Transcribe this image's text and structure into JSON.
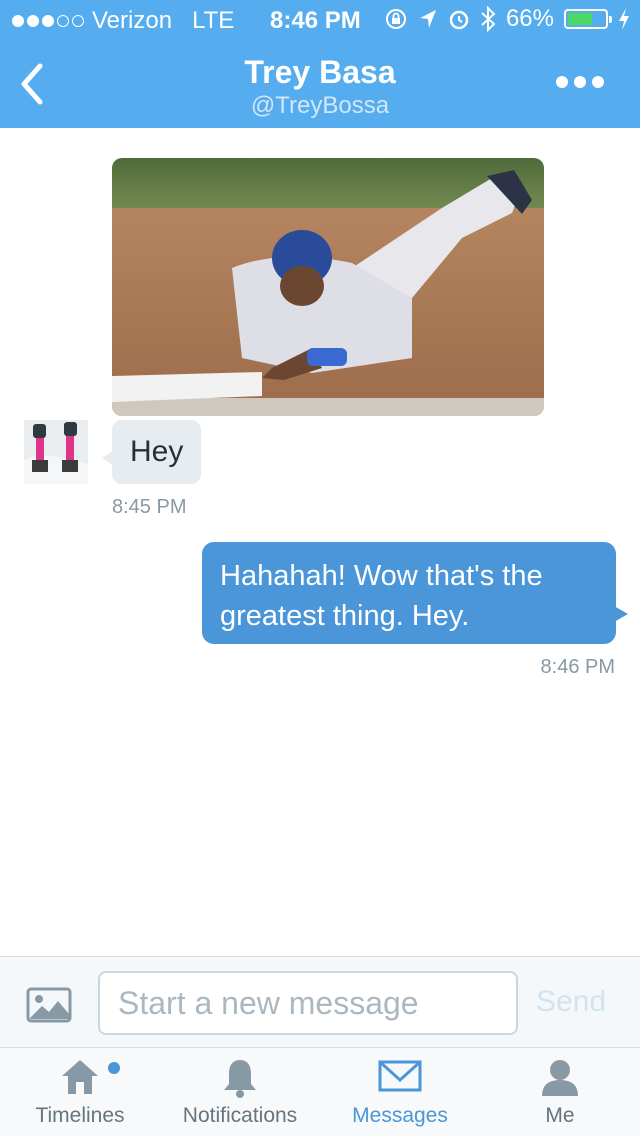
{
  "status_bar": {
    "carrier": "Verizon",
    "network": "LTE",
    "time": "8:46 PM",
    "battery_percent": "66%",
    "battery_level": 0.66,
    "signal_bars": 3
  },
  "header": {
    "title": "Trey Basa",
    "handle": "@TreyBossa",
    "back_icon": "chevron-left-icon",
    "more_icon": "more-horizontal-icon"
  },
  "conversation": {
    "incoming": {
      "image_subject": "baseball player sliding into base",
      "text": "Hey",
      "time": "8:45 PM"
    },
    "outgoing": {
      "text": "Hahahah! Wow that's the greatest thing. Hey.",
      "time": "8:46 PM"
    }
  },
  "composer": {
    "placeholder": "Start a new message",
    "send_label": "Send",
    "image_icon": "image-icon"
  },
  "tabbar": {
    "tabs": [
      {
        "label": "Timelines",
        "icon": "home-icon",
        "active": false,
        "has_badge_dot": true
      },
      {
        "label": "Notifications",
        "icon": "bell-icon",
        "active": false
      },
      {
        "label": "Messages",
        "icon": "envelope-icon",
        "active": true
      },
      {
        "label": "Me",
        "icon": "person-icon",
        "active": false
      }
    ]
  },
  "colors": {
    "header_bg": "#55acee",
    "outgoing_bubble": "#4a96d9",
    "incoming_bubble": "#e6ecf0",
    "active_tab": "#4a96d9",
    "battery_green": "#4cd964"
  }
}
